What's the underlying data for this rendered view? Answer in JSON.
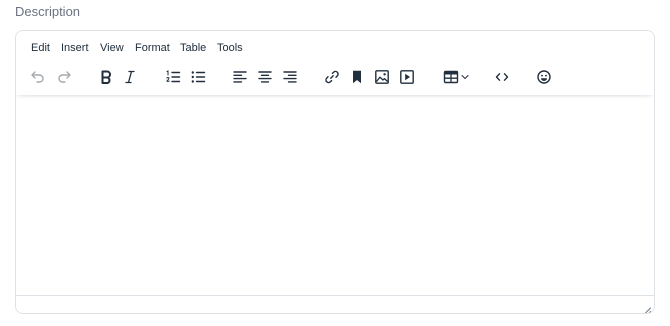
{
  "field": {
    "label": "Description"
  },
  "editor": {
    "menubar": [
      "Edit",
      "Insert",
      "View",
      "Format",
      "Table",
      "Tools"
    ],
    "toolbar": [
      {
        "name": "undo",
        "icon": "undo-icon",
        "enabled": false
      },
      {
        "name": "redo",
        "icon": "redo-icon",
        "enabled": false
      },
      {
        "name": "bold",
        "icon": "bold-icon",
        "enabled": true
      },
      {
        "name": "italic",
        "icon": "italic-icon",
        "enabled": true
      },
      {
        "name": "numbered-list",
        "icon": "numbered-list-icon",
        "enabled": true
      },
      {
        "name": "bullet-list",
        "icon": "bullet-list-icon",
        "enabled": true
      },
      {
        "name": "align-left",
        "icon": "align-left-icon",
        "enabled": true
      },
      {
        "name": "align-center",
        "icon": "align-center-icon",
        "enabled": true
      },
      {
        "name": "align-right",
        "icon": "align-right-icon",
        "enabled": true
      },
      {
        "name": "link",
        "icon": "link-icon",
        "enabled": true
      },
      {
        "name": "bookmark",
        "icon": "bookmark-icon",
        "enabled": true
      },
      {
        "name": "image",
        "icon": "image-icon",
        "enabled": true
      },
      {
        "name": "media",
        "icon": "media-icon",
        "enabled": true
      },
      {
        "name": "table",
        "icon": "table-icon",
        "enabled": true
      },
      {
        "name": "code",
        "icon": "code-icon",
        "enabled": true
      },
      {
        "name": "emoji",
        "icon": "emoji-icon",
        "enabled": true
      }
    ],
    "content": ""
  },
  "colors": {
    "icon": "#222f3e",
    "icon_disabled": "#a6a9ae",
    "label": "#6b7280",
    "border": "#dee2e6"
  }
}
